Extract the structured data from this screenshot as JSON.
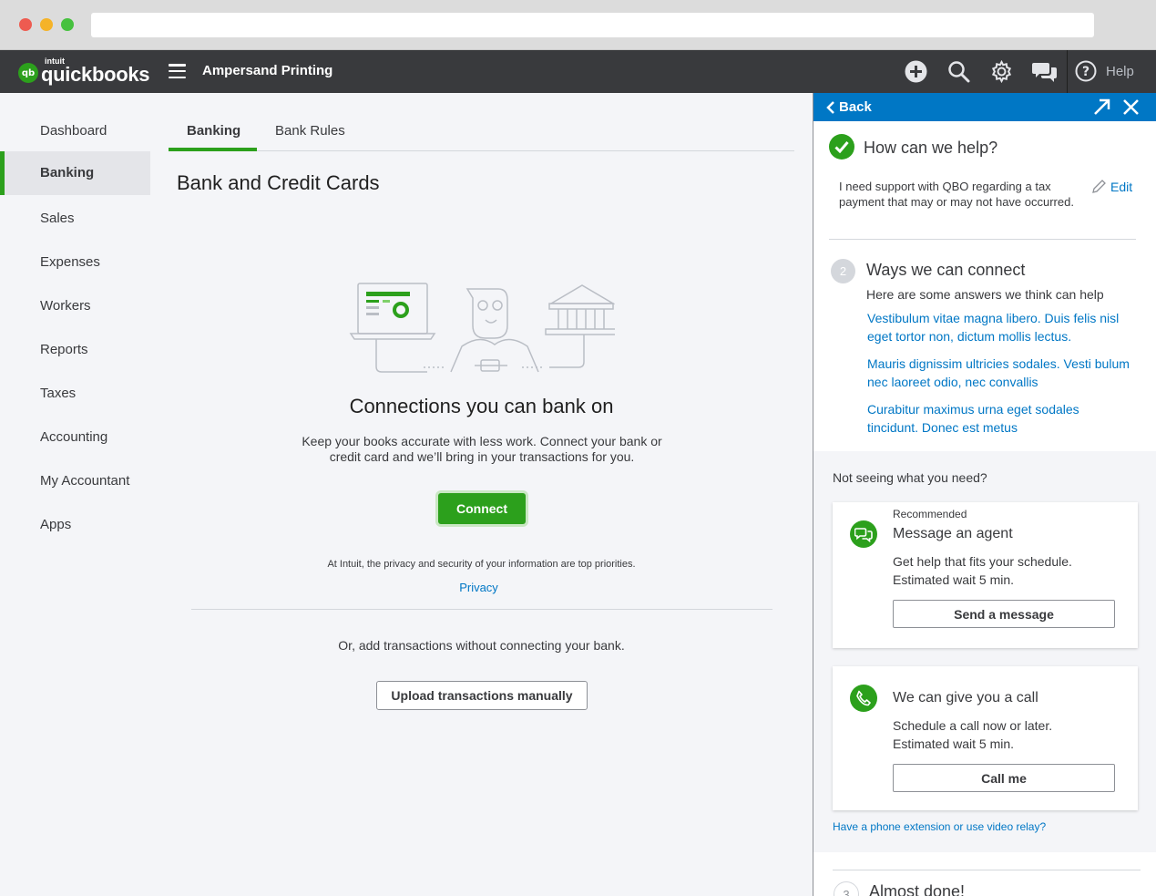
{
  "app": {
    "logo_brand": "intuit",
    "logo_name": "quickbooks",
    "company_name": "Ampersand Printing",
    "help_label": "Help"
  },
  "colors": {
    "brand_green": "#2ca01c",
    "nav_dark": "#393a3d",
    "link_blue": "#0077c5"
  },
  "sidebar": {
    "items": [
      {
        "label": "Dashboard"
      },
      {
        "label": "Banking"
      },
      {
        "label": "Sales"
      },
      {
        "label": "Expenses"
      },
      {
        "label": "Workers"
      },
      {
        "label": "Reports"
      },
      {
        "label": "Taxes"
      },
      {
        "label": "Accounting"
      },
      {
        "label": "My Accountant"
      },
      {
        "label": "Apps"
      }
    ],
    "active": "Banking"
  },
  "main": {
    "tabs": [
      {
        "label": "Banking"
      },
      {
        "label": "Bank Rules"
      }
    ],
    "page_title": "Bank and Credit Cards",
    "hero_title": "Connections you can bank on",
    "hero_desc": "Keep your books accurate with less work. Connect your bank or credit card and we’ll bring in your transactions for you.",
    "connect_label": "Connect",
    "privacy_note": "At Intuit, the privacy and security of your information are top priorities.",
    "privacy_link": "Privacy",
    "or_text": "Or, add transactions without connecting your bank.",
    "upload_label": "Upload transactions manually"
  },
  "help_panel": {
    "back_label": "Back",
    "step1_title": "How can we help?",
    "query": "I need support with QBO regarding a tax payment that may or may not have occurred.",
    "edit_label": "Edit",
    "step2_number": "2",
    "step2_title": "Ways we can connect",
    "step2_sub": "Here are some answers we think can help",
    "answers": [
      {
        "text": "Vestibulum vitae magna libero. Duis felis nisl eget tortor non, dictum mollis lectus."
      },
      {
        "text": "Mauris dignissim ultricies sodales. Vesti bulum nec laoreet odio, nec convallis"
      },
      {
        "text": "Curabitur maximus urna eget sodales tincidunt. Donec est metus"
      }
    ],
    "not_seeing": "Not seeing what you need?",
    "message_card": {
      "recommended": "Recommended",
      "title": "Message an agent",
      "desc_line1": "Get help that fits your schedule.",
      "desc_line2": "Estimated wait 5 min.",
      "button": "Send a message"
    },
    "call_card": {
      "title": "We can give you a call",
      "desc_line1": "Schedule a call now or later.",
      "desc_line2": "Estimated wait 5 min.",
      "button": "Call me"
    },
    "phone_link": "Have a phone extension or use video relay?",
    "step3_number": "3",
    "step3_title": "Almost done!"
  }
}
